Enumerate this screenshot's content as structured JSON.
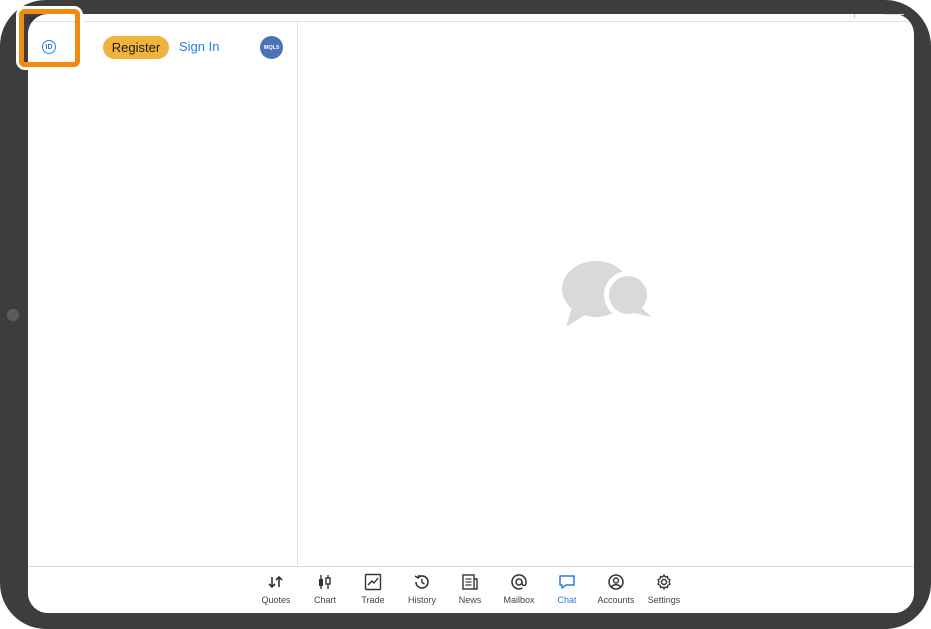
{
  "sidebar": {
    "id_icon_text": "ID",
    "register_label": "Register",
    "signin_label": "Sign In",
    "badge_text": "MQL5"
  },
  "main": {
    "empty_icon": "chat-bubbles-icon"
  },
  "tabs": [
    {
      "label": "Quotes",
      "icon": "quotes-icon"
    },
    {
      "label": "Chart",
      "icon": "chart-icon"
    },
    {
      "label": "Trade",
      "icon": "trade-icon"
    },
    {
      "label": "History",
      "icon": "history-icon"
    },
    {
      "label": "News",
      "icon": "news-icon"
    },
    {
      "label": "Mailbox",
      "icon": "mailbox-icon"
    },
    {
      "label": "Chat",
      "icon": "chat-icon",
      "active": true
    },
    {
      "label": "Accounts",
      "icon": "accounts-icon"
    },
    {
      "label": "Settings",
      "icon": "settings-icon"
    }
  ],
  "colors": {
    "accent": "#2a7de1",
    "register": "#f1b43a",
    "highlight": "#f28a12",
    "frame": "#3d3d3d"
  }
}
